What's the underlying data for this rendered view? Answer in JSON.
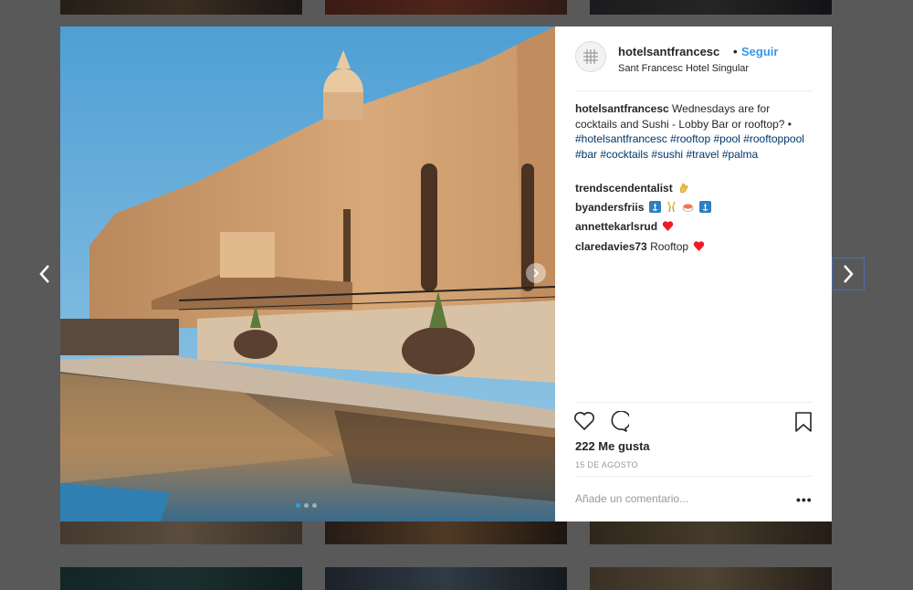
{
  "post": {
    "username": "hotelsantfrancesc",
    "follow_separator": "•",
    "follow_label": "Seguir",
    "location": "Sant Francesc Hotel Singular",
    "caption_user": "hotelsantfrancesc",
    "caption_text": " Wednesdays are for cocktails and Sushi - Lobby Bar or rooftop? • ",
    "hashtags": [
      "#hotelsantfrancesc",
      "#rooftop",
      "#pool",
      "#rooftoppool",
      "#bar",
      "#cocktails",
      "#sushi",
      "#travel",
      "#palma"
    ],
    "comments": [
      {
        "user": "trendscendentalist",
        "text": "",
        "emoji": [
          "clapping-hand-emoji"
        ]
      },
      {
        "user": "byandersfriis",
        "text": "",
        "emoji": [
          "anchor-emoji",
          "champagne-emoji",
          "sushi-emoji",
          "anchor-emoji"
        ]
      },
      {
        "user": "annettekarlsrud",
        "text": "",
        "emoji": [
          "red-heart-emoji"
        ]
      },
      {
        "user": "claredavies73",
        "text": "Rooftop",
        "emoji": [
          "red-heart-emoji"
        ]
      }
    ],
    "likes": "222 Me gusta",
    "date": "15 DE AGOSTO",
    "comment_placeholder": "Añade un comentario...",
    "more_label": "•••",
    "carousel": {
      "count": 3,
      "active_index": 1
    }
  },
  "icons": {
    "like": "heart-outline-icon",
    "comment": "speech-bubble-icon",
    "save": "bookmark-icon",
    "prev": "chevron-left-icon",
    "next": "chevron-right-icon"
  },
  "colors": {
    "follow": "#3897f0",
    "hashtag": "#003569",
    "overlay": "#595959",
    "heart": "#ed1c24"
  }
}
